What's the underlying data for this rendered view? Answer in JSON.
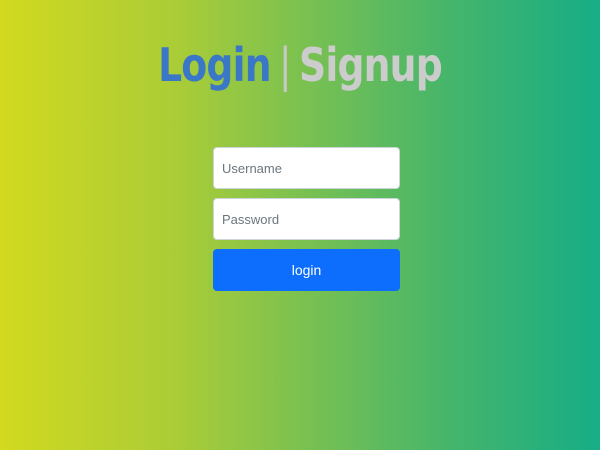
{
  "header": {
    "login_tab": "Login",
    "separator": "|",
    "signup_tab": "Signup"
  },
  "form": {
    "username_placeholder": "Username",
    "password_placeholder": "Password",
    "login_button": "login"
  },
  "colors": {
    "login_tab": "#3a77c7",
    "signup_tab": "#cccccc",
    "button": "#0d6efd",
    "gradient_left": "#d2d91f",
    "gradient_right": "#17ad86"
  }
}
